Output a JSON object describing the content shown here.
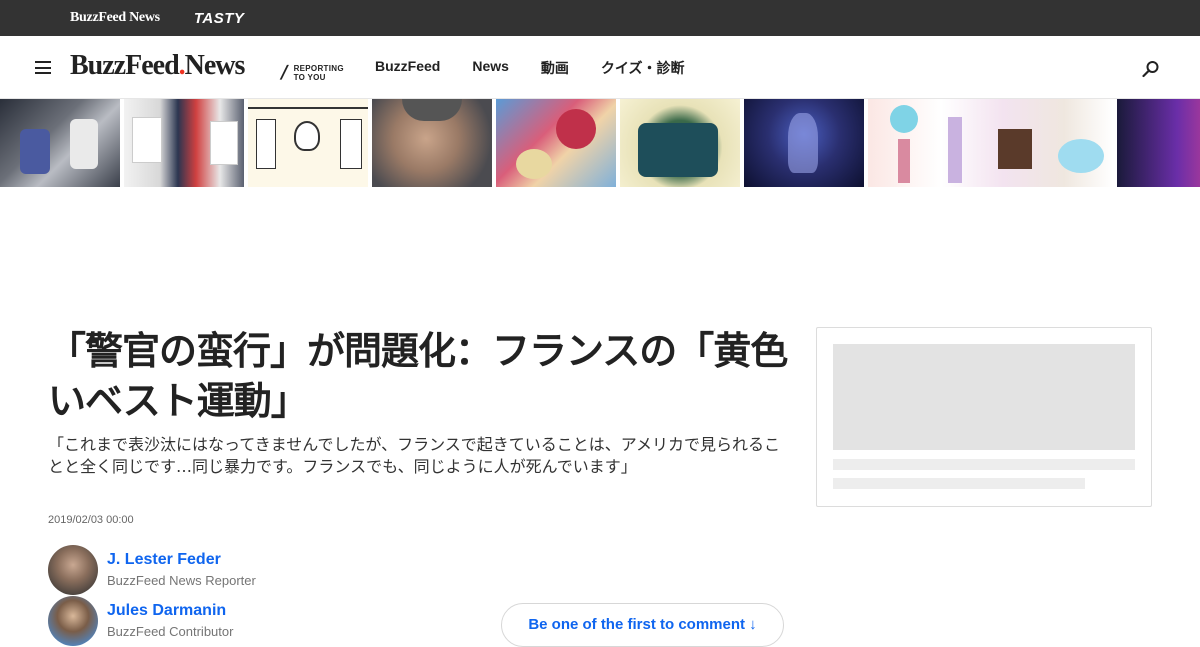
{
  "topbar": {
    "brand": "BuzzFeed News",
    "tasty": "TASTY"
  },
  "nav": {
    "logo_main": "BuzzFeed",
    "logo_news": "News",
    "tagline_line1": "REPORTING",
    "tagline_line2": "TO YOU",
    "links": [
      "BuzzFeed",
      "News",
      "動画",
      "クイズ・診断"
    ],
    "icons": {
      "menu": "hamburger-menu-icon",
      "search": "search-icon",
      "next": "chevron-right-icon"
    }
  },
  "strip": {
    "thumbnails": [
      "protest-crowd-thumbnail",
      "press-conference-thumbnail",
      "manga-comic-thumbnail",
      "man-portrait-thumbnail",
      "anime-characters-thumbnail",
      "pineapple-bag-thumbnail",
      "night-forest-thumbnail",
      "cosmetics-thumbnail",
      "neon-sign-thumbnail"
    ]
  },
  "article": {
    "headline": "「警官の蛮行」が問題化：フランスの「黄色いベスト運動」",
    "dek": "「これまで表沙汰にはなってきませんでしたが、フランスで起きていることは、アメリカで見られることと全く同じです…同じ暴力です。フランスでも、同じように人が死んでいます」",
    "timestamp": "2019/02/03 00:00",
    "authors": [
      {
        "name": "J. Lester Feder",
        "role": "BuzzFeed News Reporter"
      },
      {
        "name": "Jules Darmanin",
        "role": "BuzzFeed Contributor"
      }
    ],
    "comment_cta": "Be one of the first to comment ↓"
  },
  "colors": {
    "topbar_bg": "#333333",
    "link_blue": "#0f65ef",
    "logo_dot": "#ee3322"
  }
}
